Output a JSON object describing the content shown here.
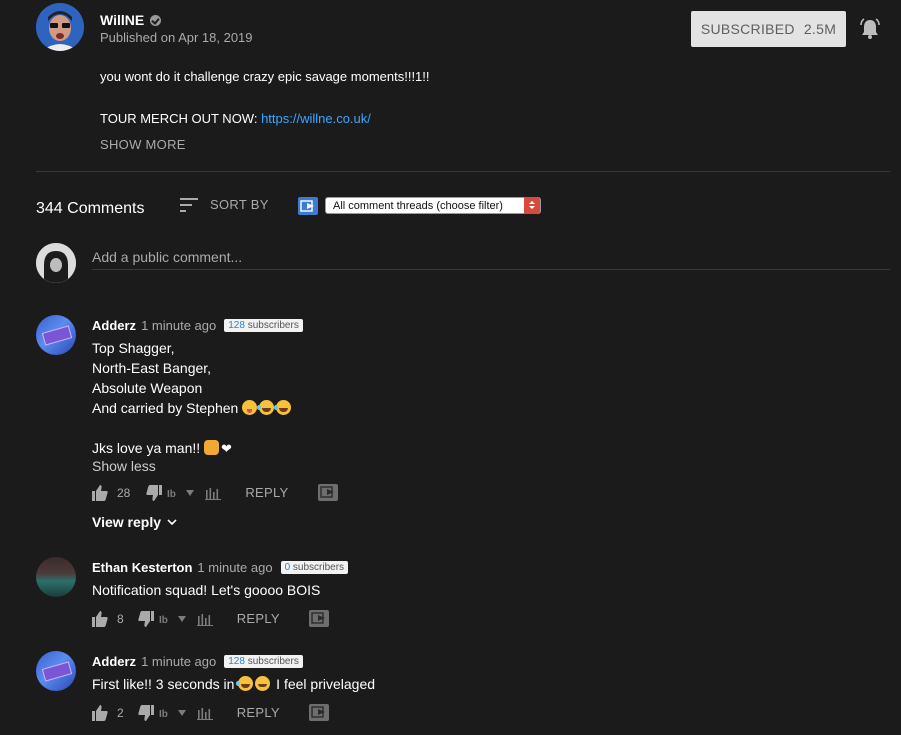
{
  "channel": {
    "name": "WillNE",
    "published": "Published on Apr 18, 2019"
  },
  "subscribe": {
    "label": "SUBSCRIBED",
    "count": "2.5M"
  },
  "description": {
    "line1": "you wont do it challenge crazy epic savage moments!!!1!!",
    "line2_prefix": "TOUR MERCH OUT NOW: ",
    "line2_link": "https://willne.co.uk/",
    "show_more": "SHOW MORE"
  },
  "comments_header": {
    "count_label": "344 Comments",
    "sort_label": "SORT BY",
    "filter_value": "All comment threads (choose filter)"
  },
  "add_comment": {
    "placeholder": "Add a public comment..."
  },
  "comments": [
    {
      "author": "Adderz",
      "time": "1 minute ago",
      "subs_num": "128",
      "subs_label": " subscribers",
      "lines": [
        "Top Shagger,",
        "North-East Banger,",
        "Absolute Weapon",
        "And carried by Stephen",
        "Jks love ya man!!"
      ],
      "show_less": "Show less",
      "likes": "28",
      "reply": "REPLY",
      "view_reply": "View reply"
    },
    {
      "author": "Ethan Kesterton",
      "time": "1 minute ago",
      "subs_num": "0",
      "subs_label": " subscribers",
      "text": "Notification squad! Let's goooo BOIS",
      "likes": "8",
      "reply": "REPLY"
    },
    {
      "author": "Adderz",
      "time": "1 minute ago",
      "subs_num": "128",
      "subs_label": " subscribers",
      "text_before": "First like!! 3 seconds in",
      "text_after": " I feel privelaged",
      "likes": "2",
      "reply": "REPLY"
    }
  ],
  "colors": {
    "background": "#1b1b1b",
    "link": "#3ea6ff",
    "muted": "#aaaaaa",
    "subscribe_bg": "#e3e3e3"
  },
  "icons": [
    "verified-icon",
    "bell-icon",
    "sort-icon",
    "extension-icon",
    "thumbs-up-icon",
    "thumbs-down-icon",
    "dislike-count-icon",
    "stats-icon",
    "chevron-down-icon"
  ]
}
